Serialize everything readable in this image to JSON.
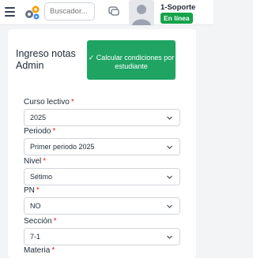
{
  "header": {
    "search_placeholder": "Buscador...",
    "user_name": "1-Soporte",
    "status": "En línea",
    "status_color": "#16a34a"
  },
  "icons": {
    "menu": "hamburger-icon",
    "gears": "gears-icon",
    "chat": "chat-icon",
    "avatar": "user-avatar-icon",
    "check": "check-icon",
    "chevron": "chevron-down-icon"
  },
  "page": {
    "title": "Ingreso notas Admin",
    "calc_button_icon": "✓",
    "calc_button_label": "Calcular condiciones por estudiante",
    "accent_color": "#1fa463"
  },
  "form": {
    "fields": [
      {
        "label": "Curso lectivo",
        "value": "2025"
      },
      {
        "label": "Periodo",
        "value": "Primer periodo 2025"
      },
      {
        "label": "Nivel",
        "value": "Sétimo"
      },
      {
        "label": "PN",
        "value": "NO"
      },
      {
        "label": "Sección",
        "value": "7-1"
      },
      {
        "label": "Materia",
        "value": ""
      }
    ],
    "required_mark": "*"
  }
}
